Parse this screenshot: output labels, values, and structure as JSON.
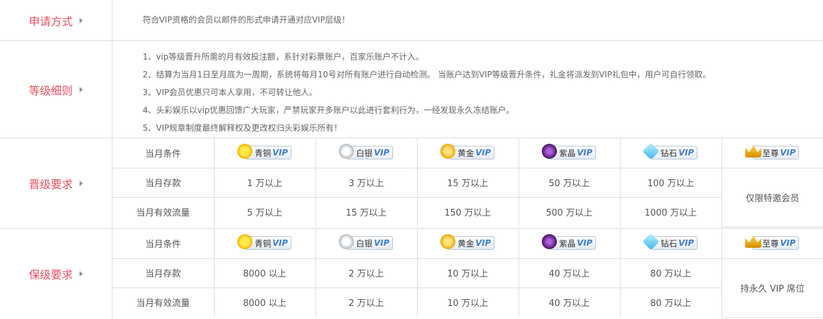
{
  "sections": {
    "apply": {
      "label": "申请方式",
      "text": "符合VIP资格的会员以邮件的形式申请开通对应VIP层级！"
    },
    "details": {
      "label": "等级细则",
      "rules": [
        "1、vip等级晋升所需的月有效投注额，系针对彩票账户，百家乐账户不计入。",
        "2、结算为当月1日至月底为一周期，系统将每月10号对所有账户进行自动检测。 当账户达到VIP等级晋升条件，礼金将派发到VIP礼包中，用户可自行领取。",
        "3、VIP会员优惠只可本人享用，不可转让他人。",
        "4、头彩娱乐以vip优惠回馈广大玩家，严禁玩家开多账户以此进行套利行为，一经发现永久冻结账户。",
        "5、VIP规章制度最终解释权及更改权归头彩娱乐所有！"
      ]
    },
    "promotion": {
      "label": "晋级要求",
      "row_labels": [
        "当月条件",
        "当月存款",
        "当月有效流量"
      ],
      "deposit": [
        "1 万以上",
        "3 万以上",
        "15 万以上",
        "50 万以上",
        "100 万以上"
      ],
      "flow": [
        "5 万以上",
        "15 万以上",
        "150 万以上",
        "500 万以上",
        "1000 万以上"
      ],
      "special": "仅限特邀会员"
    },
    "retention": {
      "label": "保级要求",
      "row_labels": [
        "当月条件",
        "当月存款",
        "当月有效流量"
      ],
      "deposit": [
        "8000 以上",
        "2 万以上",
        "10 万以上",
        "40 万以上",
        "80 万以上"
      ],
      "flow": [
        "8000 以上",
        "2 万以上",
        "10 万以上",
        "40 万以上",
        "80 万以上"
      ],
      "special": "持永久 VIP 席位"
    }
  },
  "tiers": [
    {
      "name": "青铜",
      "vip": "VIP",
      "icon": "sun-badge-icon"
    },
    {
      "name": "白银",
      "vip": "VIP",
      "icon": "silver-coin-icon"
    },
    {
      "name": "黄金",
      "vip": "VIP",
      "icon": "gold-coin-icon"
    },
    {
      "name": "紫晶",
      "vip": "VIP",
      "icon": "purple-gem-icon"
    },
    {
      "name": "钻石",
      "vip": "VIP",
      "icon": "diamond-icon"
    },
    {
      "name": "至尊",
      "vip": "VIP",
      "icon": "crown-icon"
    }
  ],
  "colors": {
    "label": "#e8515e",
    "border": "#dedede",
    "vip": "#3f7fd1"
  }
}
